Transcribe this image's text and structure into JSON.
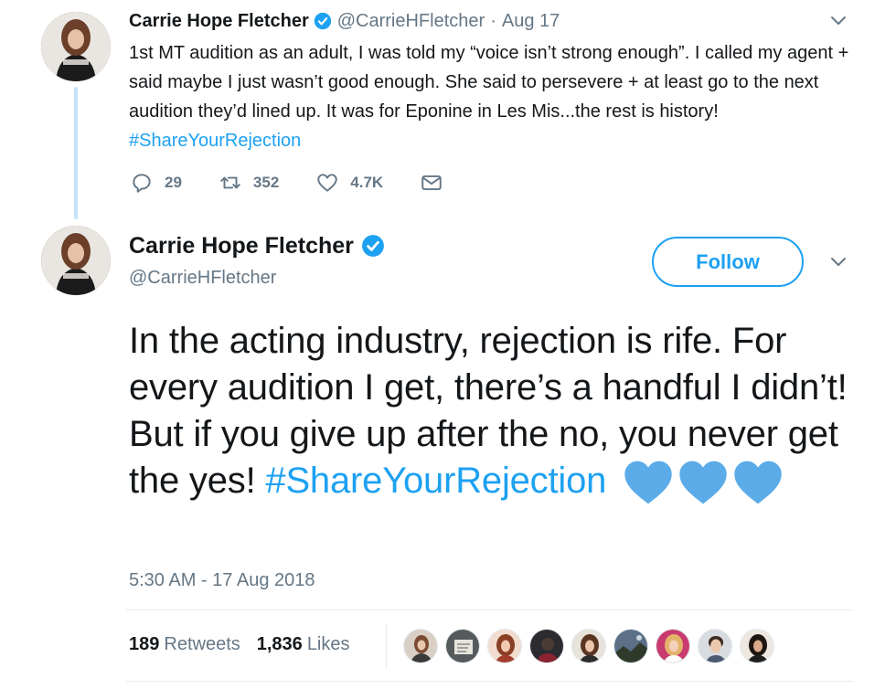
{
  "tweet1": {
    "author_name": "Carrie Hope Fletcher",
    "handle": "@CarrieHFletcher",
    "separator": "·",
    "date": "Aug 17",
    "text_main": "1st MT audition as an adult, I was told my “voice isn’t strong enough”. I called my agent + said maybe I just wasn’t good enough. She said to persevere + at least go to the next audition they’d lined up. It was for Eponine in Les Mis...the rest is history! ",
    "hashtag": "#ShareYourRejection",
    "actions": {
      "reply_count": "29",
      "retweet_count": "352",
      "like_count": "4.7K"
    }
  },
  "tweet2": {
    "author_name": "Carrie Hope Fletcher",
    "handle": "@CarrieHFletcher",
    "follow_label": "Follow",
    "text_main": "In the acting industry, rejection is rife. For every audition I get, there’s a handful I didn’t! But if you give up after the no, you never get the yes! ",
    "hashtag": "#ShareYourRejection",
    "timestamp": "5:30 AM - 17 Aug 2018",
    "stats": {
      "retweets_count": "189",
      "retweets_label": "Retweets",
      "likes_count": "1,836",
      "likes_label": "Likes"
    }
  },
  "icons": {
    "verified": "verified-badge-icon",
    "chevron": "chevron-down-icon",
    "reply": "reply-icon",
    "retweet": "retweet-icon",
    "like": "heart-icon",
    "dm": "envelope-icon",
    "emoji": "blue-heart-emoji"
  },
  "colors": {
    "accent": "#1da1f2",
    "text": "#14171a",
    "secondary": "#657786",
    "thread_line": "#c4e3f8",
    "heart_emoji": "#5aabe8"
  }
}
